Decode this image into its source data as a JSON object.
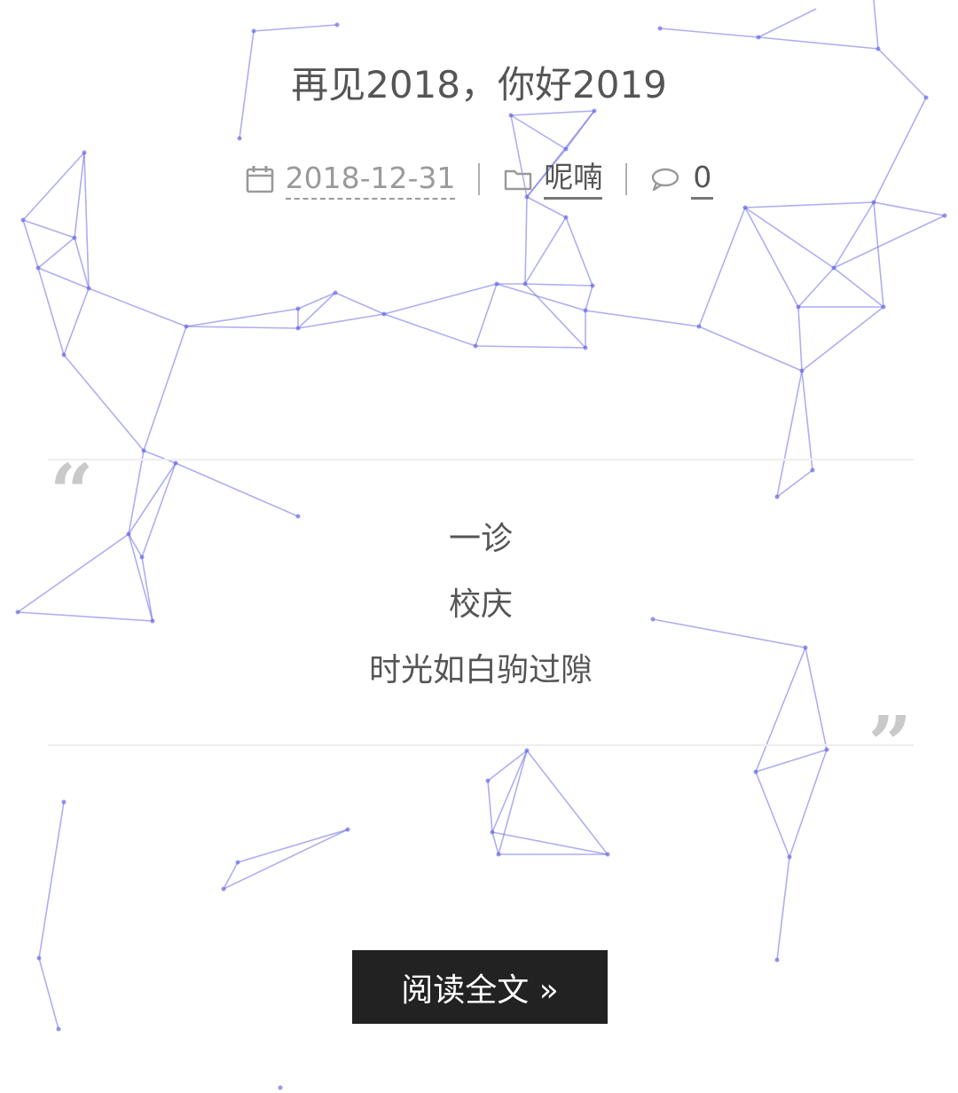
{
  "post": {
    "title": "再见2018，你好2019",
    "date": "2018-12-31",
    "category": "呢喃",
    "comment_count": "0"
  },
  "excerpt": {
    "open_quote": "“",
    "close_quote": "”",
    "lines": [
      "一诊",
      "校庆",
      "时光如白驹过隙"
    ]
  },
  "read_more_label": "阅读全文 »",
  "colors": {
    "network_line": "#6b6be8",
    "title": "#555555",
    "button_bg": "#222222"
  },
  "icons": {
    "date": "calendar-icon",
    "category": "folder-icon",
    "comments": "comment-bubble-icon"
  }
}
